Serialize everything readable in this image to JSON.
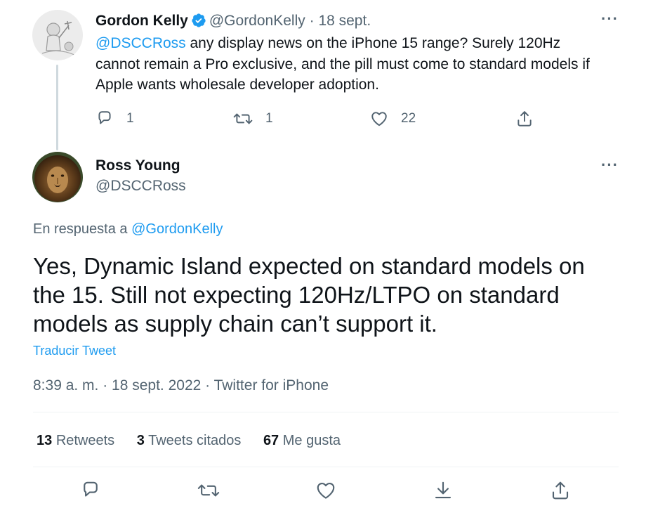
{
  "parent_tweet": {
    "author_name": "Gordon Kelly",
    "author_handle": "@GordonKelly",
    "separator": "·",
    "date": "18 sept.",
    "mention": "@DSCCRoss",
    "text_line1_rest": " any display news on the iPhone 15 range? Surely 120Hz",
    "text_line2": "cannot remain a Pro exclusive, and the pill must come to standard models if",
    "text_line3": "Apple wants wholesale developer adoption.",
    "reply_count": "1",
    "retweet_count": "1",
    "like_count": "22"
  },
  "main_tweet": {
    "author_name": "Ross Young",
    "author_handle": "@DSCCRoss",
    "reply_prefix": "En respuesta a ",
    "reply_to_handle": "@GordonKelly",
    "text": "Yes, Dynamic Island expected on standard models on the 15. Still not expecting 120Hz/LTPO on standard models as supply chain can’t support it.",
    "translate_label": "Traducir Tweet",
    "meta": "8:39 a. m. · 18 sept. 2022 · Twitter for iPhone",
    "retweets_count": "13",
    "retweets_label": "Retweets",
    "quotes_count": "3",
    "quotes_label": "Tweets citados",
    "likes_count": "67",
    "likes_label": "Me gusta"
  },
  "colors": {
    "accent": "#1d9bf0",
    "secondary_text": "#536471",
    "primary_text": "#0f1419",
    "divider": "#eff3f4"
  },
  "icons": [
    "verified-badge-icon",
    "more-icon",
    "reply-icon",
    "retweet-icon",
    "like-icon",
    "share-icon",
    "bookmark-icon"
  ]
}
